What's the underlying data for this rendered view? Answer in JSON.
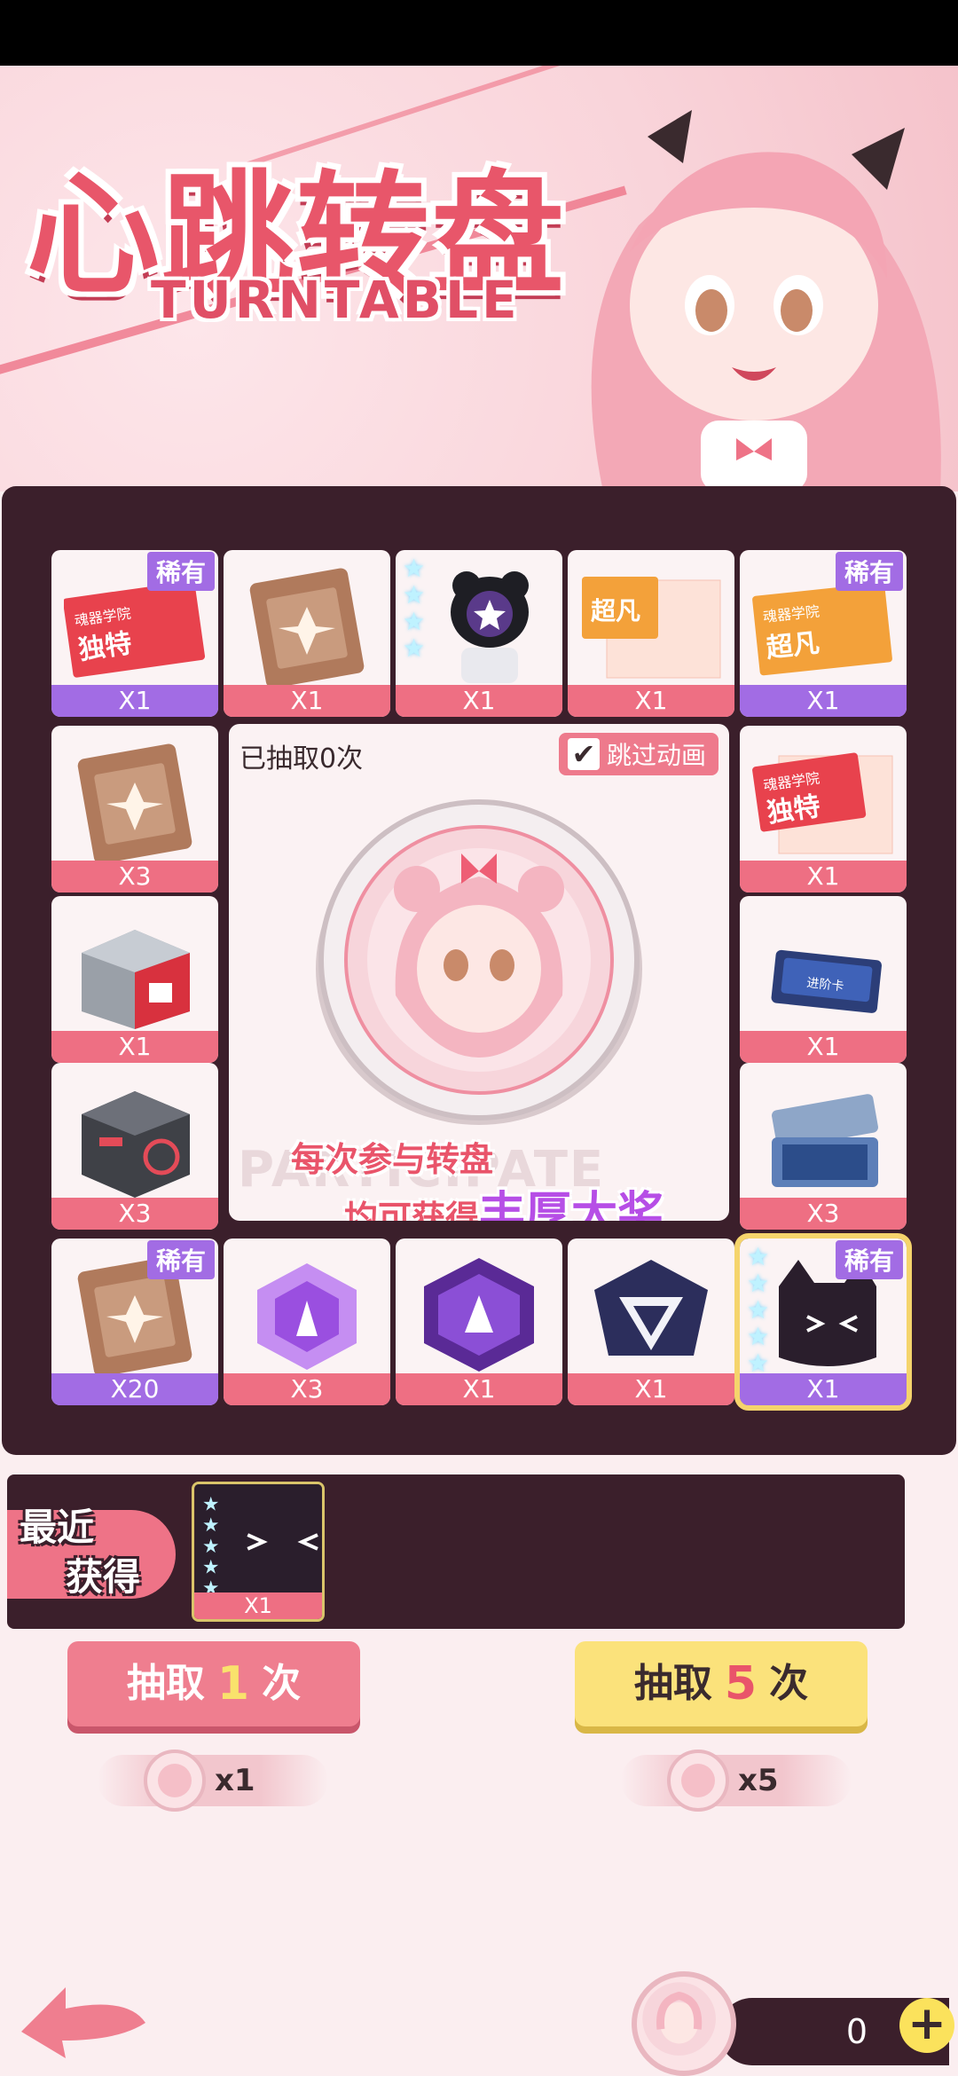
{
  "banner": {
    "title_cn": "心跳转盘",
    "title_en": "TURNTABLE"
  },
  "center": {
    "draw_count": "已抽取0次",
    "skip_animation": "跳过动画",
    "ghost_text": "PARTICIPATE",
    "promo_line1": "每次参与转盘",
    "promo_line2_prefix": "均可获得",
    "promo_line2_highlight": "丰厚大奖"
  },
  "tags": {
    "rare": "稀有"
  },
  "cells": [
    {
      "qty": "X1",
      "tag": "稀有",
      "icon": "red-ticket-icon",
      "ticket_school": "魂器学院",
      "ticket_grade": "独特"
    },
    {
      "qty": "X1",
      "icon": "brown-card-icon"
    },
    {
      "qty": "X1",
      "icon": "panda-character-icon"
    },
    {
      "qty": "X1",
      "icon": "orange-ticket-icon",
      "ticket_school": "",
      "ticket_grade": "超凡"
    },
    {
      "qty": "X1",
      "tag": "稀有",
      "icon": "orange-ticket-icon",
      "ticket_school": "魂器学院",
      "ticket_grade": "超凡"
    },
    {
      "qty": "X3",
      "icon": "brown-card-icon"
    },
    {
      "qty": "X1",
      "icon": "red-ticket-icon",
      "ticket_school": "魂器学院",
      "ticket_grade": "独特"
    },
    {
      "qty": "X1",
      "icon": "red-chest-icon"
    },
    {
      "qty": "X1",
      "icon": "blue-card-icon",
      "card_label": "进阶卡"
    },
    {
      "qty": "X3",
      "icon": "grey-cube-icon"
    },
    {
      "qty": "X3",
      "icon": "blue-case-icon"
    },
    {
      "qty": "X20",
      "tag": "稀有",
      "icon": "brown-card-icon"
    },
    {
      "qty": "X3",
      "icon": "purple-hex-icon"
    },
    {
      "qty": "X1",
      "icon": "purple-emblem-icon"
    },
    {
      "qty": "X1",
      "icon": "triangle-badge-icon"
    },
    {
      "qty": "X1",
      "tag": "稀有",
      "icon": "black-cat-icon"
    }
  ],
  "recent": {
    "label_line1": "最近",
    "label_line2": "获得",
    "item_qty": "X1",
    "item_icon": "black-cat-icon"
  },
  "buttons": {
    "draw_one": {
      "prefix": "抽取",
      "num": "1",
      "suffix": "次"
    },
    "draw_five": {
      "prefix": "抽取",
      "num": "5",
      "suffix": "次"
    }
  },
  "costs": {
    "one": "x1",
    "five": "x5"
  },
  "balance": {
    "value": "0",
    "plus": "+"
  },
  "colors": {
    "board": "#3b1f2b",
    "accent_pink": "#ee7387",
    "accent_purple": "#a26ce4",
    "accent_yellow": "#fbe27b"
  }
}
